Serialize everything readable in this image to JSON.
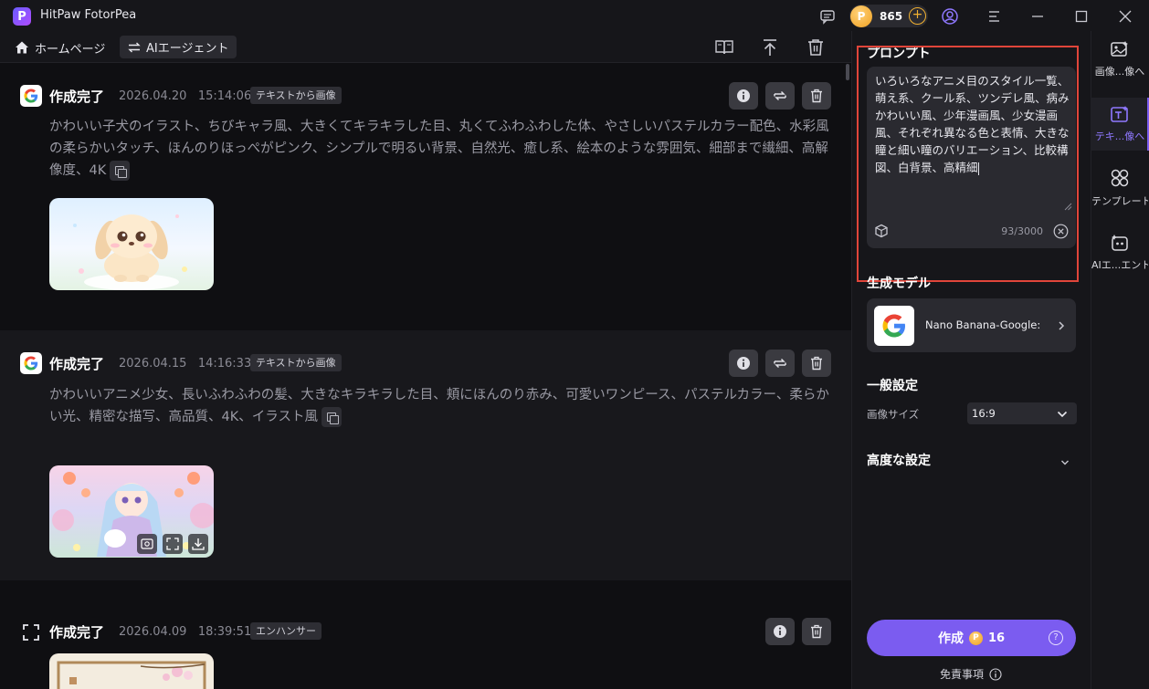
{
  "app": {
    "title": "HitPaw FotorPea",
    "logo_letter": "P",
    "credits": "865",
    "coin_symbol": "P"
  },
  "nav": {
    "home_label": "ホームページ",
    "agent_label": "AIエージェント"
  },
  "entries": [
    {
      "status": "作成完了",
      "datetime": "2026.04.20   15:14:06",
      "tag": "テキストから画像",
      "icon": "google-icon",
      "text": "かわいい子犬のイラスト、ちびキャラ風、大きくてキラキラした目、丸くてふわふわした体、やさしいパステルカラー配色、水彩風の柔らかいタッチ、ほんのりほっぺがピンク、シンプルで明るい背景、自然光、癒し系、絵本のような雰囲気、細部まで繊細、高解像度、4K"
    },
    {
      "status": "作成完了",
      "datetime": "2026.04.15   14:16:33",
      "tag": "テキストから画像",
      "icon": "google-icon",
      "text": "かわいいアニメ少女、長いふわふわの髪、大きなキラキラした目、頬にほんのり赤み、可愛いワンピース、パステルカラー、柔らかい光、精密な描写、高品質、4K、イラスト風"
    },
    {
      "status": "作成完了",
      "datetime": "2026.04.09   18:39:51",
      "tag": "エンハンサー",
      "icon": "enhance-icon"
    }
  ],
  "panel": {
    "prompt_title": "プロンプト",
    "prompt_text": "いろいろなアニメ目のスタイル一覧、萌え系、クール系、ツンデレ風、病みかわいい風、少年漫画風、少女漫画風、それぞれ異なる色と表情、大きな瞳と細い瞳のバリエーション、比較構図、白背景、高精細",
    "prompt_count": "93/3000",
    "model_title": "生成モデル",
    "model_name": "Nano Banana-Google:...",
    "general_title": "一般設定",
    "image_size_label": "画像サイズ",
    "image_size_value": "16:9",
    "advanced_title": "高度な設定",
    "create_label": "作成",
    "create_cost": "16",
    "disclaimer": "免責事項"
  },
  "rail": [
    {
      "label": "画像...像へ",
      "icon": "image-icon"
    },
    {
      "label": "テキ...像へ",
      "icon": "text-image-icon",
      "active": true
    },
    {
      "label": "テンプレート",
      "icon": "template-icon"
    },
    {
      "label": "AIエ...エント",
      "icon": "agent-icon"
    }
  ],
  "colors": {
    "accent": "#7b5cf0",
    "highlight_frame": "#e0453a",
    "google_blue": "#4285f4"
  }
}
